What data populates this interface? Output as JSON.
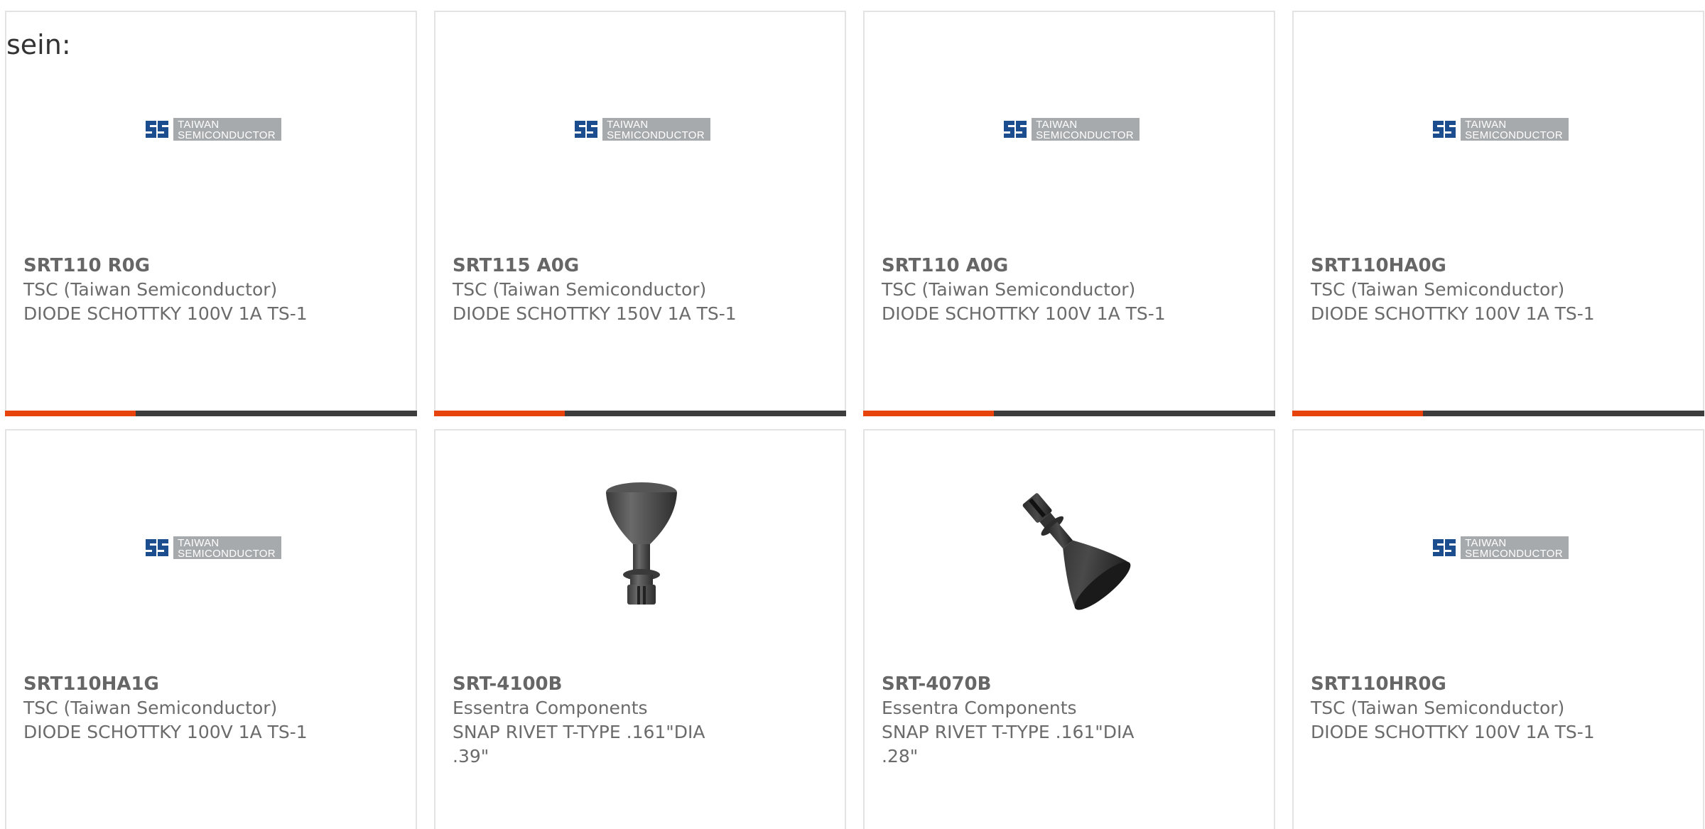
{
  "intro_text": "sein:",
  "products": [
    {
      "part": "SRT110 R0G",
      "maker": "TSC (Taiwan Semiconductor)",
      "desc": "DIODE SCHOTTKY 100V 1A TS-1",
      "image": "tsc-logo",
      "logo_line1": "TAIWAN",
      "logo_line2": "SEMICONDUCTOR"
    },
    {
      "part": "SRT115 A0G",
      "maker": "TSC (Taiwan Semiconductor)",
      "desc": "DIODE SCHOTTKY 150V 1A TS-1",
      "image": "tsc-logo",
      "logo_line1": "TAIWAN",
      "logo_line2": "SEMICONDUCTOR"
    },
    {
      "part": "SRT110 A0G",
      "maker": "TSC (Taiwan Semiconductor)",
      "desc": "DIODE SCHOTTKY 100V 1A TS-1",
      "image": "tsc-logo",
      "logo_line1": "TAIWAN",
      "logo_line2": "SEMICONDUCTOR"
    },
    {
      "part": "SRT110HA0G",
      "maker": "TSC (Taiwan Semiconductor)",
      "desc": "DIODE SCHOTTKY 100V 1A TS-1",
      "image": "tsc-logo",
      "logo_line1": "TAIWAN",
      "logo_line2": "SEMICONDUCTOR"
    },
    {
      "part": "SRT110HA1G",
      "maker": "TSC (Taiwan Semiconductor)",
      "desc": "DIODE SCHOTTKY 100V 1A TS-1",
      "image": "tsc-logo",
      "logo_line1": "TAIWAN",
      "logo_line2": "SEMICONDUCTOR"
    },
    {
      "part": "SRT-4100B",
      "maker": "Essentra Components",
      "desc": "SNAP RIVET T-TYPE .161\"DIA .39\"",
      "image": "snap-rivet-upright"
    },
    {
      "part": "SRT-4070B",
      "maker": "Essentra Components",
      "desc": "SNAP RIVET T-TYPE .161\"DIA .28\"",
      "image": "snap-rivet-tilted"
    },
    {
      "part": "SRT110HR0G",
      "maker": "TSC (Taiwan Semiconductor)",
      "desc": "DIODE SCHOTTKY 100V 1A TS-1",
      "image": "tsc-logo",
      "logo_line1": "TAIWAN",
      "logo_line2": "SEMICONDUCTOR"
    }
  ],
  "colors": {
    "accent": "#e8430c",
    "bar": "#3d3d3d",
    "text": "#6b6b6b",
    "logo_blue": "#1c4e8f",
    "logo_gray": "#a7aaad"
  }
}
